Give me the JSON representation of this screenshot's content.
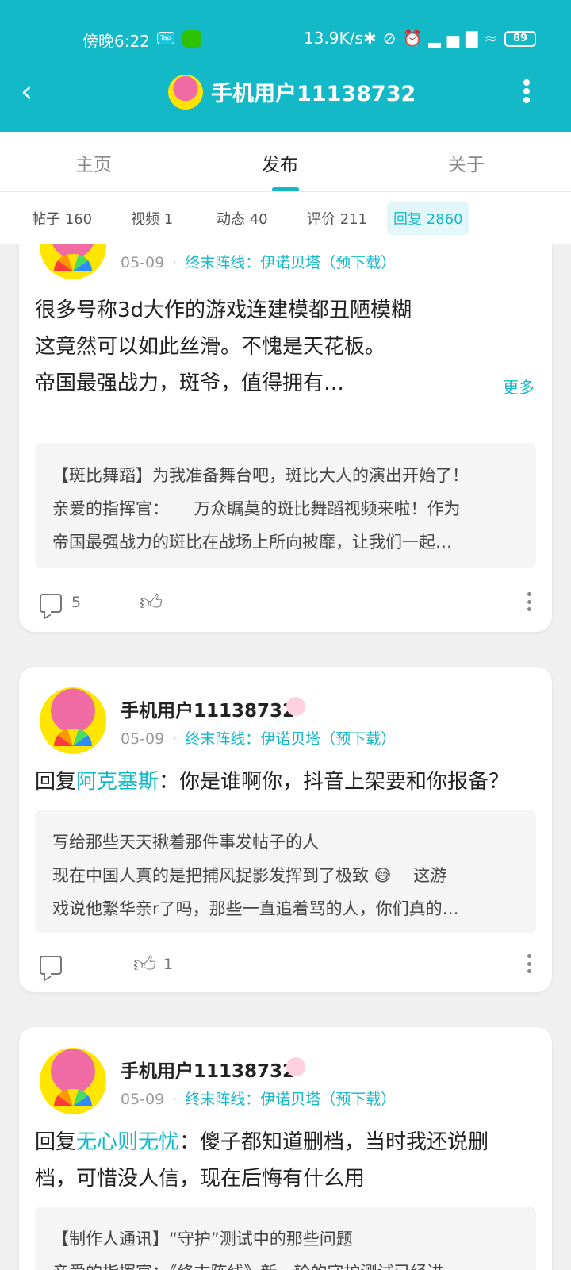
{
  "status": {
    "time": "傍晚6:22",
    "tap_label": "Tap",
    "speed": "13.9K/s",
    "icons": "✱⊘⏰▂▅▇≈",
    "battery": "89"
  },
  "header": {
    "back_icon": "‹",
    "title": "手机用户11138732"
  },
  "tabs": [
    "主页",
    "发布",
    "关于"
  ],
  "subtabs": [
    "帖子 160",
    "视频 1",
    "动态 40",
    "评价 211",
    "回复 2860"
  ],
  "posts": [
    {
      "date": "05-09",
      "dot": "·",
      "game": "终末阵线：伊诺贝塔（预下载）",
      "lines": [
        "很多号称3d大作的游戏连建模都丑陋模糊",
        "这竟然可以如此丝滑。不愧是天花板。",
        "帝国最强战力，斑爷，值得拥有…"
      ],
      "more": "更多",
      "quote": [
        "【斑比舞蹈】为我准备舞台吧，斑比大人的演出开始了！",
        "亲爱的指挥官：　　万众瞩莫的斑比舞蹈视频来啦！作为",
        "帝国最强战力的斑比在战场上所向披靡，让我们一起…"
      ],
      "comments": "5",
      "likes": ""
    },
    {
      "username": "手机用户11138732",
      "date": "05-09",
      "dot": "·",
      "game": "终末阵线：伊诺贝塔（预下载）",
      "reply_prefix": "回复",
      "reply_to": "阿克塞斯",
      "reply_text": "：你是谁啊你，抖音上架要和你报备？",
      "quote": [
        "写给那些天天揪着那件事发帖子的人",
        "现在中国人真的是把捕风捉影发挥到了极致 😅　 这游",
        "戏说他繁华亲r了吗，那些一直追着骂的人，你们真的…"
      ],
      "comments": "",
      "likes": "1"
    },
    {
      "username": "手机用户11138732",
      "date": "05-09",
      "dot": "·",
      "game": "终末阵线：伊诺贝塔（预下载）",
      "reply_prefix": "回复",
      "reply_to": "无心则无忧",
      "reply_text": "：傻子都知道删档，当时我还说删",
      "reply_text2": "档，可惜没人信，现在后悔有什么用",
      "quote": [
        "【制作人通讯】“守护”测试中的那些问题",
        "亲爱的指挥官：《终末阵线》新一轮的守护测试已经进"
      ]
    }
  ]
}
